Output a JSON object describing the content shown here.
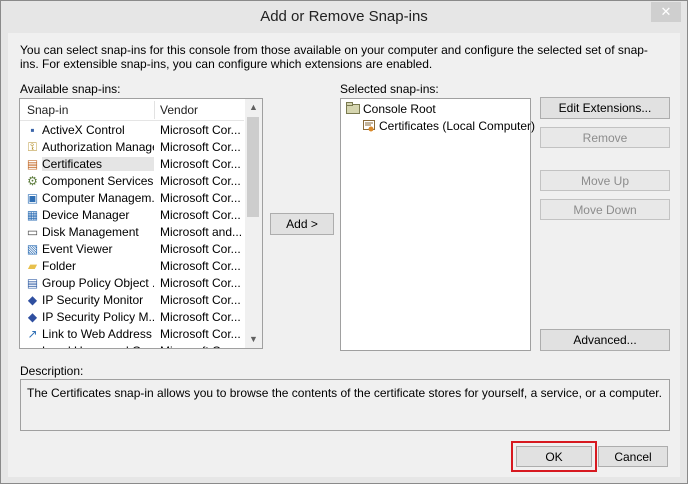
{
  "window": {
    "title": "Add or Remove Snap-ins",
    "close_glyph": "✕"
  },
  "intro_text": "You can select snap-ins for this console from those available on your computer and configure the selected set of snap-ins. For extensible snap-ins, you can configure which extensions are enabled.",
  "available": {
    "label": "Available snap-ins:",
    "col_snapin": "Snap-in",
    "col_vendor": "Vendor",
    "items": [
      {
        "name": "ActiveX Control",
        "vendor": "Microsoft Cor...",
        "icon": "activex-icon"
      },
      {
        "name": "Authorization Manager",
        "vendor": "Microsoft Cor...",
        "icon": "authorization-icon"
      },
      {
        "name": "Certificates",
        "vendor": "Microsoft Cor...",
        "icon": "certificates-icon"
      },
      {
        "name": "Component Services",
        "vendor": "Microsoft Cor...",
        "icon": "component-services-icon"
      },
      {
        "name": "Computer Managem...",
        "vendor": "Microsoft Cor...",
        "icon": "computer-management-icon"
      },
      {
        "name": "Device Manager",
        "vendor": "Microsoft Cor...",
        "icon": "device-manager-icon"
      },
      {
        "name": "Disk Management",
        "vendor": "Microsoft and...",
        "icon": "disk-management-icon"
      },
      {
        "name": "Event Viewer",
        "vendor": "Microsoft Cor...",
        "icon": "event-viewer-icon"
      },
      {
        "name": "Folder",
        "vendor": "Microsoft Cor...",
        "icon": "folder-icon"
      },
      {
        "name": "Group Policy Object ...",
        "vendor": "Microsoft Cor...",
        "icon": "group-policy-icon"
      },
      {
        "name": "IP Security Monitor",
        "vendor": "Microsoft Cor...",
        "icon": "ip-security-monitor-icon"
      },
      {
        "name": "IP Security Policy M...",
        "vendor": "Microsoft Cor...",
        "icon": "ip-security-policy-icon"
      },
      {
        "name": "Link to Web Address",
        "vendor": "Microsoft Cor...",
        "icon": "link-icon"
      },
      {
        "name": "Local Users and Gro...",
        "vendor": "Microsoft Cor...",
        "icon": "local-users-icon"
      }
    ],
    "selected_index": 2
  },
  "add_button": "Add >",
  "selected": {
    "label": "Selected snap-ins:",
    "root": "Console Root",
    "child": "Certificates (Local Computer)"
  },
  "side_buttons": {
    "edit_extensions": "Edit Extensions...",
    "remove": "Remove",
    "move_up": "Move Up",
    "move_down": "Move Down",
    "advanced": "Advanced..."
  },
  "description": {
    "label": "Description:",
    "text": "The Certificates snap-in allows you to browse the contents of the certificate stores for yourself, a service, or a computer."
  },
  "footer": {
    "ok": "OK",
    "cancel": "Cancel"
  },
  "colors": {
    "highlight_border": "#d71920"
  }
}
